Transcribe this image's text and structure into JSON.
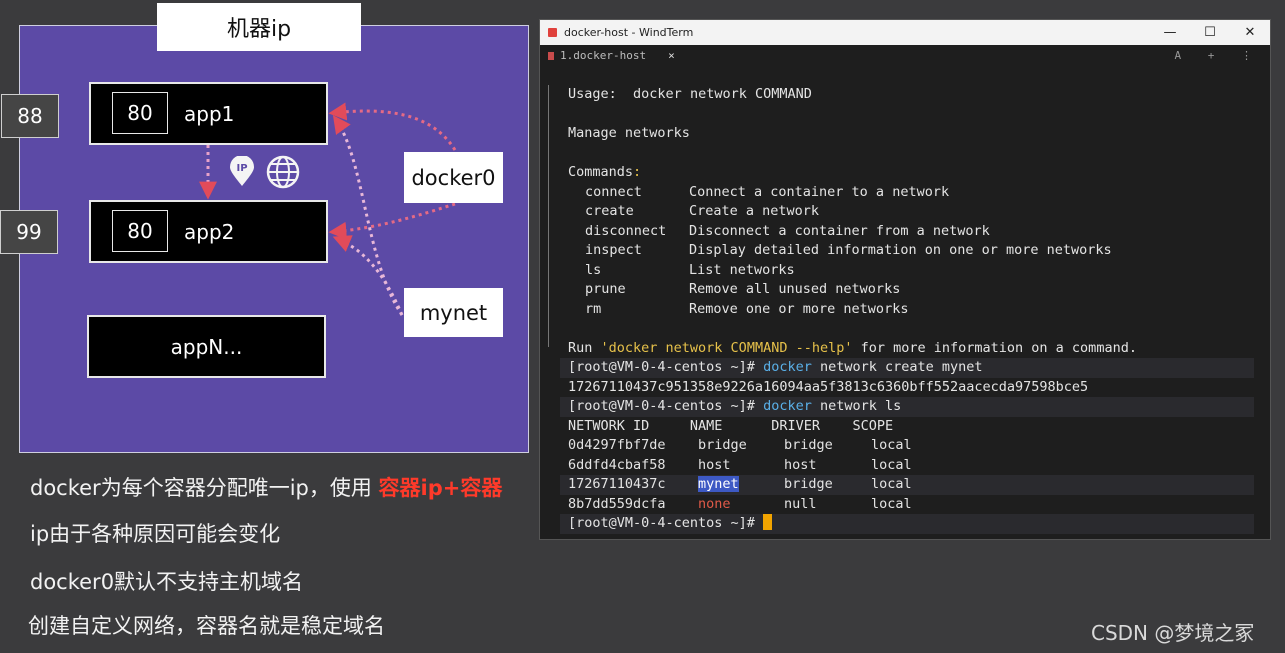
{
  "slide": {
    "title": "机器ip",
    "apps": [
      {
        "port": "80",
        "name": "app1",
        "host_port": "88"
      },
      {
        "port": "80",
        "name": "app2",
        "host_port": "99"
      },
      {
        "name": "appN..."
      }
    ],
    "networks": [
      "docker0",
      "mynet"
    ],
    "icons": [
      "ip-pin-icon",
      "globe-icon"
    ],
    "bullets": [
      {
        "text": "docker为每个容器分配唯一ip，使用 ",
        "highlight": "容器ip+容器"
      },
      {
        "text": "ip由于各种原因可能会变化"
      },
      {
        "text": "docker0默认不支持主机域名"
      },
      {
        "text": "创建自定义网络，容器名就是稳定域名"
      }
    ],
    "colors": {
      "board": "#5c4aa6",
      "arrow": "#e24b5a",
      "highlight": "#ff3a2a"
    }
  },
  "watermark": "CSDN @梦境之冢",
  "window": {
    "title": "docker-host - WindTerm",
    "tab_label": "1.docker-host",
    "tab_close": "×",
    "tab_tools": "A + ⋮",
    "controls": {
      "minimize": "—",
      "maximize": "☐",
      "close": "✕"
    }
  },
  "terminal": {
    "usage_label": "Usage:",
    "usage_cmd": "docker network COMMAND",
    "manage": "Manage networks",
    "commands_label": "Commands",
    "commands_colon": ":",
    "commands": [
      {
        "name": "connect",
        "desc": "Connect a container to a network"
      },
      {
        "name": "create",
        "desc": "Create a network"
      },
      {
        "name": "disconnect",
        "desc": "Disconnect a container from a network"
      },
      {
        "name": "inspect",
        "desc": "Display detailed information on one or more networks"
      },
      {
        "name": "ls",
        "desc": "List networks"
      },
      {
        "name": "prune",
        "desc": "Remove all unused networks"
      },
      {
        "name": "rm",
        "desc": "Remove one or more networks"
      }
    ],
    "run_pre": "Run ",
    "run_quoted": "'docker network COMMAND --help'",
    "run_post": " for more information on a command.",
    "prompt": "[root@VM-0-4-centos ~]# ",
    "cmd1_docker": "docker",
    "cmd1_rest": " network create mynet",
    "create_output": "17267110437c951358e9226a16094aa5f3813c6360bff552aacecda97598bce5",
    "cmd2_docker": "docker",
    "cmd2_rest": " network ls",
    "table_header": "NETWORK ID     NAME      DRIVER    SCOPE",
    "networks": [
      {
        "id": "0d4297fbf7de",
        "name": "bridge",
        "driver": "bridge",
        "scope": "local"
      },
      {
        "id": "6ddfd4cbaf58",
        "name": "host",
        "driver": "host",
        "scope": "local"
      },
      {
        "id": "17267110437c",
        "name": "mynet",
        "driver": "bridge",
        "scope": "local"
      },
      {
        "id": "8b7dd559dcfa",
        "name": "none",
        "driver": "null",
        "scope": "local"
      }
    ],
    "final_prompt": "[root@VM-0-4-centos ~]# "
  }
}
